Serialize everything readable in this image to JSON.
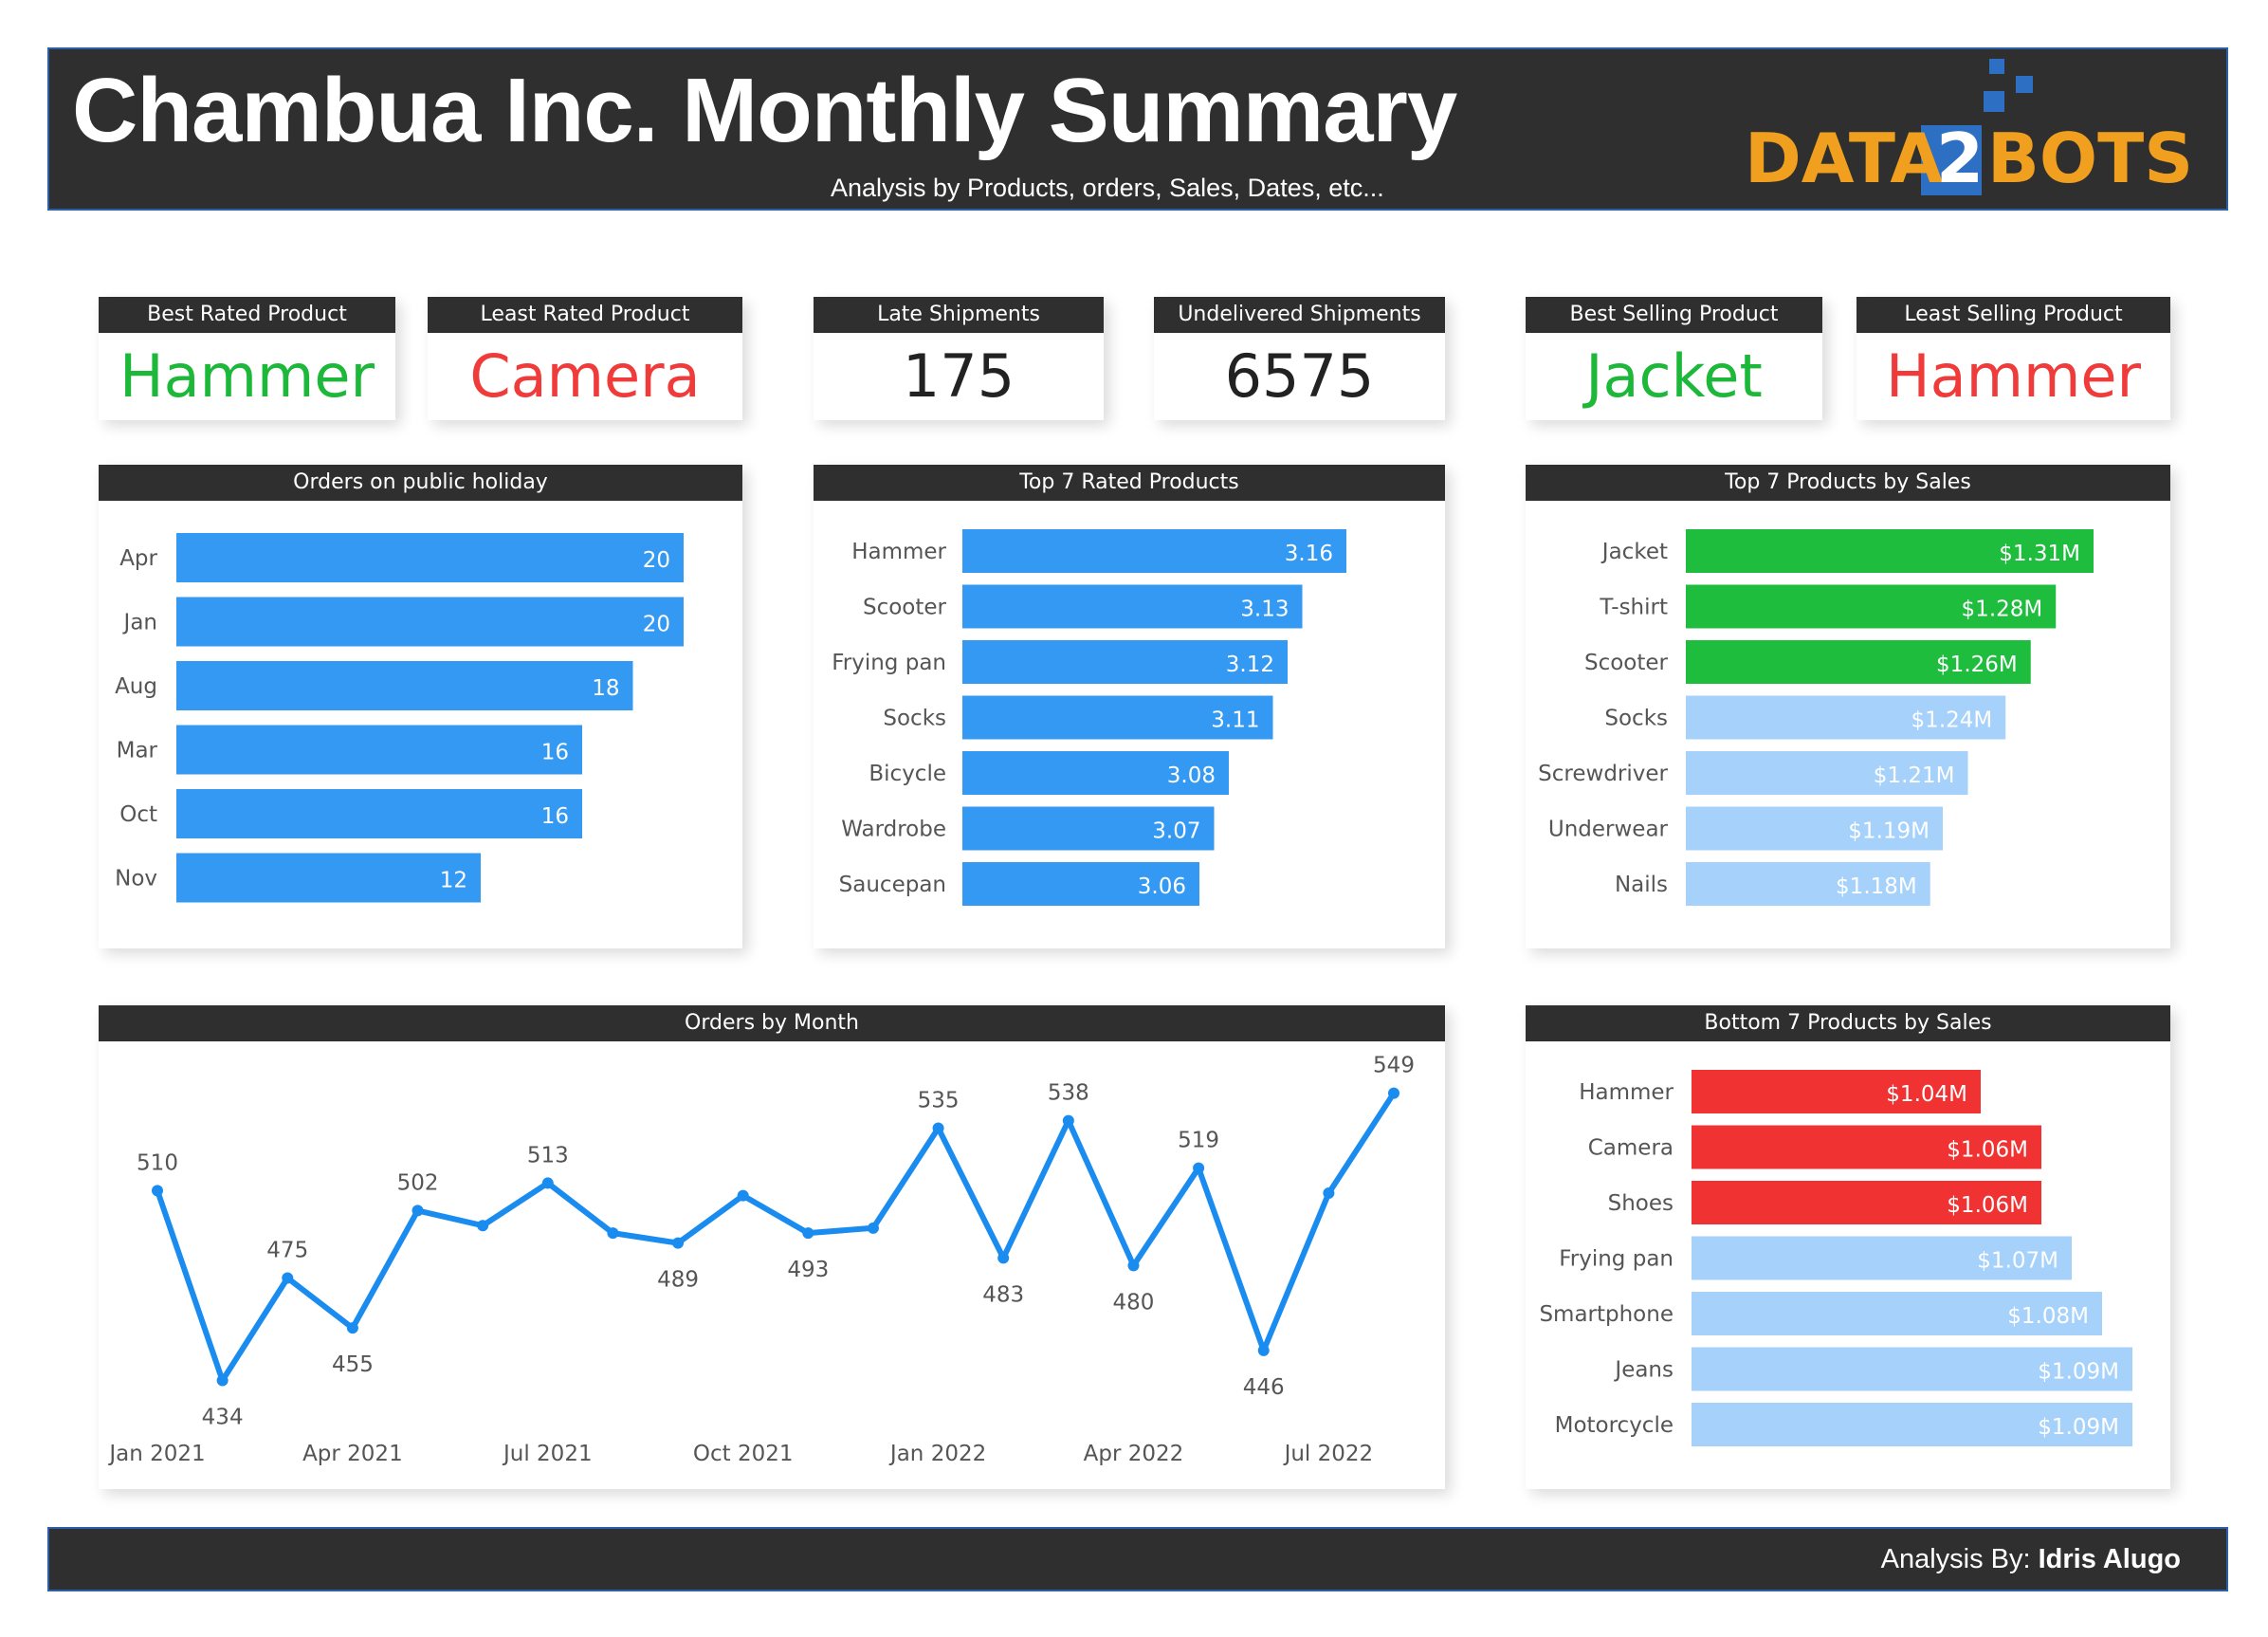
{
  "header": {
    "title": "Chambua Inc. Monthly Summary",
    "subtitle": "Analysis by Products, orders, Sales, Dates, etc...",
    "logo_text_left": "DATA",
    "logo_text_mid": "2",
    "logo_text_right": "BOTS"
  },
  "kpis": [
    {
      "label": "Best Rated Product",
      "value": "Hammer",
      "color": "#1db83a"
    },
    {
      "label": "Least Rated Product",
      "value": "Camera",
      "color": "#f03b3b"
    },
    {
      "label": "Late Shipments",
      "value": "175",
      "color": "#222222"
    },
    {
      "label": "Undelivered Shipments",
      "value": "6575",
      "color": "#222222"
    },
    {
      "label": "Best Selling Product",
      "value": "Jacket",
      "color": "#1db83a"
    },
    {
      "label": "Least Selling Product",
      "value": "Hammer",
      "color": "#f03b3b"
    }
  ],
  "footer": {
    "prefix": "Analysis By: ",
    "author": "Idris Alugo"
  },
  "colors": {
    "blue": "#3399f3",
    "green": "#1ebd3d",
    "light_blue": "#a5d1fb",
    "red": "#f03232",
    "line": "#1a8cf0"
  },
  "chart_data": [
    {
      "id": "holiday",
      "type": "bar",
      "title": "Orders on public holiday",
      "categories": [
        "Apr",
        "Jan",
        "Aug",
        "Mar",
        "Oct",
        "Nov"
      ],
      "values": [
        20,
        20,
        18,
        16,
        16,
        12
      ],
      "labels": [
        "20",
        "20",
        "18",
        "16",
        "16",
        "12"
      ],
      "xlim": [
        0,
        20
      ]
    },
    {
      "id": "rated",
      "type": "bar",
      "title": "Top 7 Rated Products",
      "categories": [
        "Hammer",
        "Scooter",
        "Frying pan",
        "Socks",
        "Bicycle",
        "Wardrobe",
        "Saucepan"
      ],
      "values": [
        3.16,
        3.13,
        3.12,
        3.11,
        3.08,
        3.07,
        3.06
      ],
      "labels": [
        "3.16",
        "3.13",
        "3.12",
        "3.11",
        "3.08",
        "3.07",
        "3.06"
      ],
      "xlim": [
        3.0,
        3.16
      ]
    },
    {
      "id": "top_sales",
      "type": "bar",
      "title": "Top 7 Products by Sales",
      "categories": [
        "Jacket",
        "T-shirt",
        "Scooter",
        "Socks",
        "Screwdriver",
        "Underwear",
        "Nails"
      ],
      "values": [
        1.31,
        1.28,
        1.26,
        1.24,
        1.21,
        1.19,
        1.18
      ],
      "labels": [
        "$1.31M",
        "$1.28M",
        "$1.26M",
        "$1.24M",
        "$1.21M",
        "$1.19M",
        "$1.18M"
      ],
      "bar_colors": [
        "green",
        "green",
        "green",
        "light_blue",
        "light_blue",
        "light_blue",
        "light_blue"
      ],
      "xlim": [
        1.11,
        1.31
      ]
    },
    {
      "id": "bottom_sales",
      "type": "bar",
      "title": "Bottom 7 Products by Sales",
      "categories": [
        "Hammer",
        "Camera",
        "Shoes",
        "Frying pan",
        "Smartphone",
        "Jeans",
        "Motorcycle"
      ],
      "values": [
        1.04,
        1.06,
        1.06,
        1.07,
        1.08,
        1.09,
        1.09
      ],
      "labels": [
        "$1.04M",
        "$1.06M",
        "$1.06M",
        "$1.07M",
        "$1.08M",
        "$1.09M",
        "$1.09M"
      ],
      "bar_colors": [
        "red",
        "red",
        "red",
        "light_blue",
        "light_blue",
        "light_blue",
        "light_blue"
      ],
      "xlim": [
        1.0,
        1.09
      ]
    },
    {
      "id": "orders_month",
      "type": "line",
      "title": "Orders by Month",
      "x": [
        "Jan 2021",
        "Feb 2021",
        "Mar 2021",
        "Apr 2021",
        "May 2021",
        "Jun 2021",
        "Jul 2021",
        "Aug 2021",
        "Sep 2021",
        "Oct 2021",
        "Nov 2021",
        "Dec 2021",
        "Jan 2022",
        "Feb 2022",
        "Mar 2022",
        "Apr 2022",
        "May 2022",
        "Jun 2022",
        "Jul 2022",
        "Aug 2022"
      ],
      "y": [
        510,
        434,
        475,
        455,
        502,
        496,
        513,
        493,
        489,
        508,
        493,
        495,
        535,
        483,
        538,
        480,
        519,
        446,
        509,
        549
      ],
      "point_labels": [
        "510",
        "434",
        "475",
        "455",
        "502",
        "",
        "513",
        "",
        "489",
        "",
        "493",
        "",
        "535",
        "483",
        "538",
        "480",
        "519",
        "446",
        "",
        "549"
      ],
      "x_tick_labels": [
        "Jan 2021",
        "Apr 2021",
        "Jul 2021",
        "Oct 2021",
        "Jan 2022",
        "Apr 2022",
        "Jul 2022"
      ],
      "x_tick_index": [
        0,
        3,
        6,
        9,
        12,
        15,
        18
      ],
      "ylim": [
        430,
        550
      ]
    }
  ]
}
